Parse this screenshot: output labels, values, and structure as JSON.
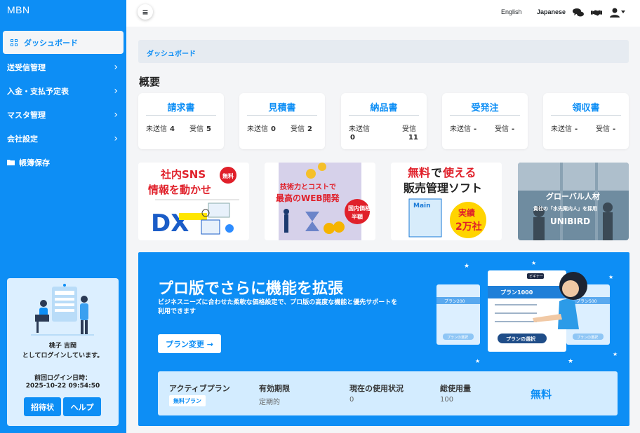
{
  "sidebar": {
    "brand": "MBN",
    "items": [
      {
        "label": "ダッシュボード",
        "active": true,
        "icon": "grid-icon"
      },
      {
        "label": "送受信管理",
        "icon": "chevron-right-icon"
      },
      {
        "label": "入金・支払予定表",
        "icon": "chevron-right-icon"
      },
      {
        "label": "マスタ管理",
        "icon": "chevron-right-icon"
      },
      {
        "label": "会社設定",
        "icon": "chevron-right-icon"
      },
      {
        "label": "帳簿保存",
        "icon": "folder-icon"
      }
    ],
    "user": {
      "name": "桃子 吉岡",
      "status": "としてログインしています。",
      "last_login_label": "前回ログイン日時：",
      "last_login_time": "2025-10-22 09:54:50",
      "invite_label": "招待状",
      "help_label": "ヘルプ"
    }
  },
  "topbar": {
    "menu_icon": "≡",
    "lang_english": "English",
    "lang_japanese": "Japanese",
    "icons": [
      "chat-icon",
      "handshake-icon",
      "user-icon"
    ]
  },
  "breadcrumb": "ダッシュボード",
  "overview": {
    "title": "概要",
    "cards": [
      {
        "title": "請求書",
        "left_label": "未送信",
        "left_value": "4",
        "right_label": "受信",
        "right_value": "5",
        "stacked": false
      },
      {
        "title": "見積書",
        "left_label": "未送信",
        "left_value": "0",
        "right_label": "受信",
        "right_value": "2",
        "stacked": false
      },
      {
        "title": "納品書",
        "left_label": "未送信",
        "left_value": "0",
        "right_label": "受信",
        "right_value": "11",
        "stacked": true
      },
      {
        "title": "受発注",
        "left_label": "未送信",
        "left_value": "-",
        "right_label": "受信",
        "right_value": "-",
        "stacked": false
      },
      {
        "title": "領収書",
        "left_label": "未送信",
        "left_value": "-",
        "right_label": "受信",
        "right_value": "-",
        "stacked": false
      }
    ]
  },
  "banners": [
    {
      "line1": "社内SNS",
      "line2": "情報を動かせ",
      "badge": "無料",
      "extra": "DX"
    },
    {
      "line1": "技術力とコストで",
      "line2": "最高のWEB開発",
      "badge1": "国内価格",
      "badge2": "半額"
    },
    {
      "line1a": "無料",
      "line1b": "で",
      "line1c": "使える",
      "line2": "販売管理ソフト",
      "badge1": "実績",
      "badge2": "2万社",
      "label": "Main"
    },
    {
      "line1": "グローバル人材",
      "line2": "貴社の「水先案内人」を採用",
      "brand": "UNIBIRD"
    }
  ],
  "promo": {
    "title": "プロ版でさらに機能を拡張",
    "description": "ビジネスニーズに合わせた柔軟な価格設定で、プロ版の高度な機能と優先サポートを利用できます",
    "button_label": "プラン変更 →",
    "illustration": {
      "center_plan": "プラン1000",
      "center_button": "プランの選択",
      "left_plan": "プラン200",
      "right_plan": "プラン500",
      "small_button": "プランの選択",
      "tag": "ビギナー"
    },
    "plan_bar": {
      "active_label": "アクティブプラン",
      "active_value": "無料プラン",
      "expiry_label": "有効期限",
      "expiry_value": "定期的",
      "usage_label": "現在の使用状況",
      "usage_value": "0",
      "total_label": "総使用量",
      "total_value": "100",
      "plan_name": "無料"
    }
  }
}
